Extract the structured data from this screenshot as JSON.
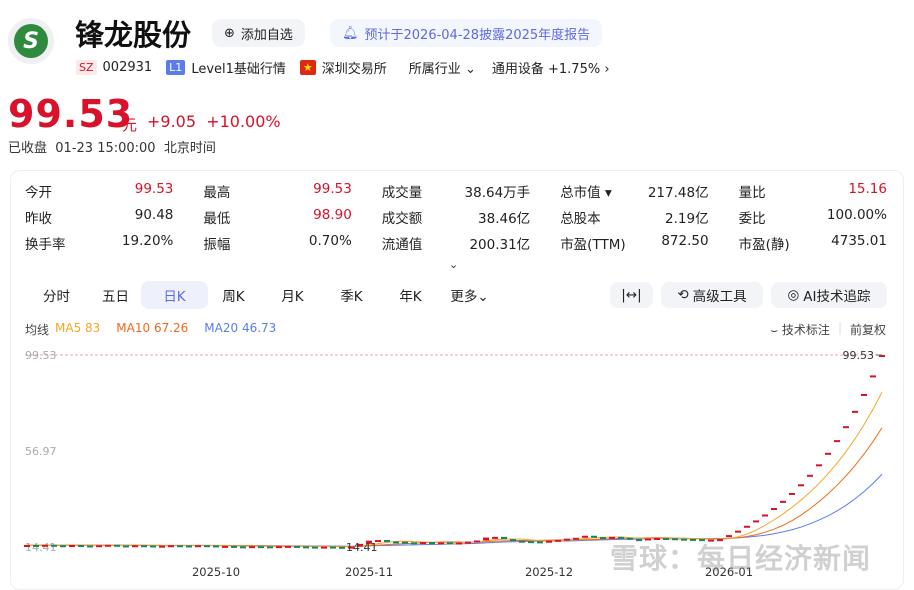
{
  "header": {
    "name": "锋龙股份",
    "logo_letter": "S",
    "add_watch": "添加自选",
    "notice": "预计于2026-04-28披露2025年度报告",
    "market_tag": "SZ",
    "code": "002931",
    "level_tag": "L1",
    "level": "Level1基础行情",
    "exchange": "深圳交易所",
    "industry_label": "所属行业",
    "industry": "通用设备",
    "industry_change": "+1.75%"
  },
  "quote": {
    "price": "99.53",
    "unit": "元",
    "change": "+9.05",
    "change_pct": "+10.00%",
    "status": "已收盘",
    "time": "01-23 15:00:00",
    "tz": "北京时间"
  },
  "stats": [
    [
      {
        "label": "今开",
        "value": "99.53",
        "red": true
      },
      {
        "label": "最高",
        "value": "99.53",
        "red": true
      },
      {
        "label": "成交量",
        "value": "38.64万手"
      },
      {
        "label": "总市值 ▾",
        "value": "217.48亿"
      },
      {
        "label": "量比",
        "value": "15.16",
        "red": true
      }
    ],
    [
      {
        "label": "昨收",
        "value": "90.48"
      },
      {
        "label": "最低",
        "value": "98.90",
        "red": true
      },
      {
        "label": "成交额",
        "value": "38.46亿"
      },
      {
        "label": "总股本",
        "value": "2.19亿"
      },
      {
        "label": "委比",
        "value": "100.00%"
      }
    ],
    [
      {
        "label": "换手率",
        "value": "19.20%"
      },
      {
        "label": "振幅",
        "value": "0.70%"
      },
      {
        "label": "流通值",
        "value": "200.31亿"
      },
      {
        "label": "市盈(TTM)",
        "value": "872.50"
      },
      {
        "label": "市盈(静)",
        "value": "4735.01"
      }
    ]
  ],
  "tabs": [
    "分时",
    "五日",
    "日K",
    "周K",
    "月K",
    "季K",
    "年K",
    "更多⌄"
  ],
  "active_tab": "日K",
  "tools": {
    "fit": "|↔|",
    "advanced": "高级工具",
    "ai": "AI技术追踪"
  },
  "ma": {
    "label": "均线",
    "ma5": "MA5 83",
    "ma10": "MA10 67.26",
    "ma20": "MA20 46.73"
  },
  "chart_tools": {
    "annot": "技术标注",
    "adjust": "前复权"
  },
  "watermark": "雪球：每日经济新闻",
  "colors": {
    "up": "#d9112a",
    "down": "#13866a",
    "ma5": "#f5a623",
    "ma10": "#f06a1a",
    "ma20": "#5b7cf0"
  },
  "chart_data": {
    "type": "candlestick",
    "y_labels": [
      "99.53",
      "56.97",
      "14.41"
    ],
    "ylim": [
      14.41,
      99.53
    ],
    "max_label": "99.53",
    "min_label": "14.41",
    "month_labels": [
      {
        "index": 21,
        "label": "2025-10"
      },
      {
        "index": 38,
        "label": "2025-11"
      },
      {
        "index": 58,
        "label": "2025-12"
      },
      {
        "index": 78,
        "label": "2026-01"
      }
    ],
    "close": [
      15.3,
      15.1,
      15.4,
      15.2,
      15.0,
      15.3,
      15.1,
      14.9,
      15.2,
      15.4,
      15.1,
      15.0,
      15.2,
      15.1,
      14.9,
      15.0,
      15.2,
      15.1,
      15.0,
      15.2,
      15.1,
      14.8,
      14.9,
      14.7,
      14.6,
      14.8,
      14.7,
      14.6,
      14.8,
      14.9,
      14.7,
      14.6,
      14.5,
      14.6,
      14.5,
      14.41,
      14.6,
      15.8,
      17.2,
      17.5,
      16.9,
      16.8,
      16.5,
      16.4,
      16.6,
      16.3,
      16.5,
      16.2,
      16.4,
      16.8,
      17.3,
      18.6,
      18.9,
      17.9,
      17.2,
      17.0,
      16.9,
      16.7,
      17.2,
      17.6,
      18.1,
      18.5,
      19.4,
      18.8,
      18.6,
      18.9,
      18.5,
      17.9,
      17.8,
      18.2,
      18.4,
      18.3,
      18.1,
      18.0,
      17.9,
      17.6,
      17.7,
      17.9,
      19.68,
      21.65,
      23.82,
      26.2,
      28.82,
      31.7,
      34.87,
      38.36,
      42.2,
      46.42,
      51.06,
      56.17,
      61.79,
      67.97,
      74.77,
      82.25,
      90.48,
      99.53
    ]
  }
}
